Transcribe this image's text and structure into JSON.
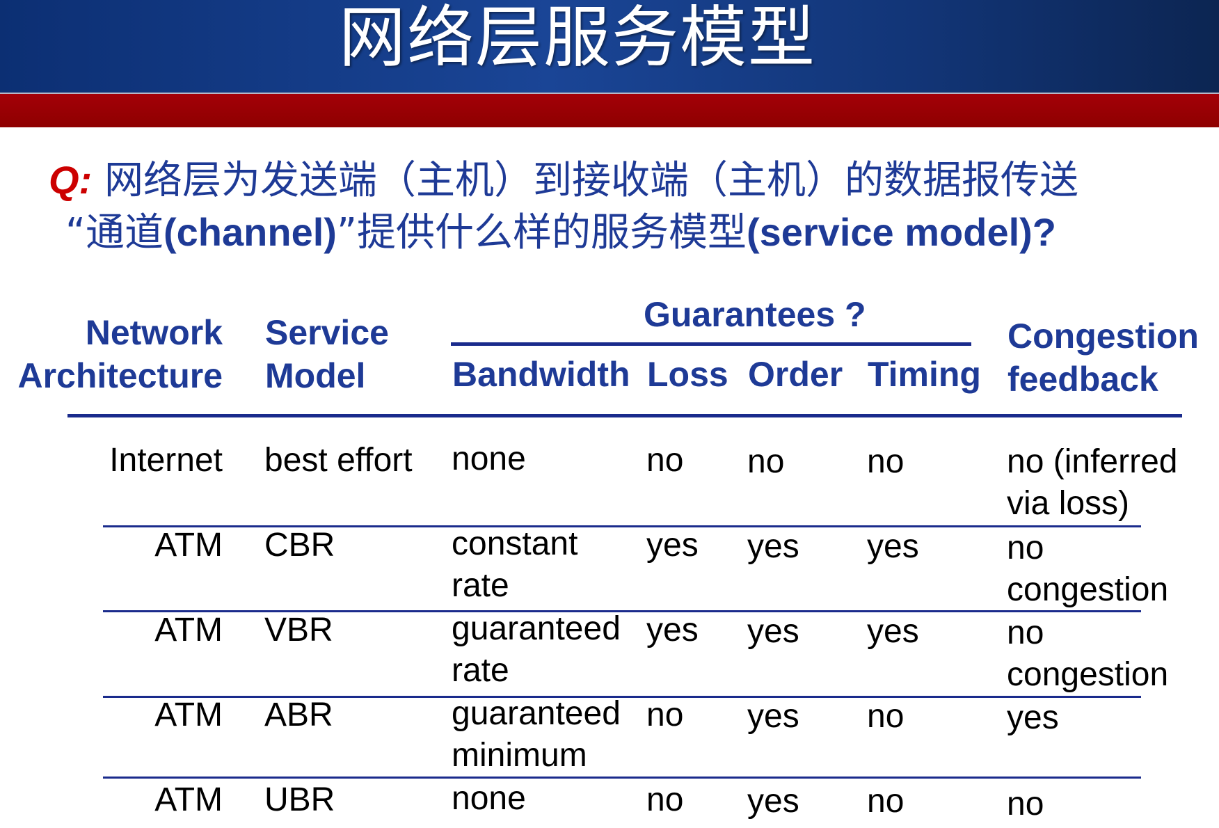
{
  "title": "网络层服务模型",
  "question": {
    "label": "Q:",
    "line1": " 网络层为发送端（主机）到接收端（主机）的数据报传送",
    "line2_prefix": "“通道",
    "line2_channel": "(channel)",
    "line2_middle": "”提供什么样的服务模型",
    "line2_model": "(service model)?"
  },
  "table": {
    "headers": {
      "network_line1": "Network",
      "network_line2": "Architecture",
      "service_line1": "Service",
      "service_line2": "Model",
      "guarantees": "Guarantees ?",
      "bandwidth": "Bandwidth",
      "loss": "Loss",
      "order": "Order",
      "timing": "Timing",
      "congestion_line1": "Congestion",
      "congestion_line2": "feedback"
    },
    "rows": [
      {
        "arch": "Internet",
        "model": "best effort",
        "bw1": "none",
        "bw2": "",
        "loss": "no",
        "order": "no",
        "timing": "no",
        "cong1": "no (inferred",
        "cong2": "via loss)"
      },
      {
        "arch": "ATM",
        "model": "CBR",
        "bw1": "constant",
        "bw2": "rate",
        "loss": "yes",
        "order": "yes",
        "timing": "yes",
        "cong1": "no",
        "cong2": "congestion"
      },
      {
        "arch": "ATM",
        "model": "VBR",
        "bw1": "guaranteed",
        "bw2": "rate",
        "loss": "yes",
        "order": "yes",
        "timing": "yes",
        "cong1": "no",
        "cong2": "congestion"
      },
      {
        "arch": "ATM",
        "model": "ABR",
        "bw1": "guaranteed",
        "bw2": "minimum",
        "loss": "no",
        "order": "yes",
        "timing": "no",
        "cong1": "yes",
        "cong2": ""
      },
      {
        "arch": "ATM",
        "model": "UBR",
        "bw1": "none",
        "bw2": "",
        "loss": "no",
        "order": "yes",
        "timing": "no",
        "cong1": "no",
        "cong2": ""
      }
    ]
  },
  "colors": {
    "title_bar": "#1a4596",
    "red_band": "#9a0000",
    "heading_blue": "#1e3a96",
    "question_label_red": "#cc0000"
  }
}
